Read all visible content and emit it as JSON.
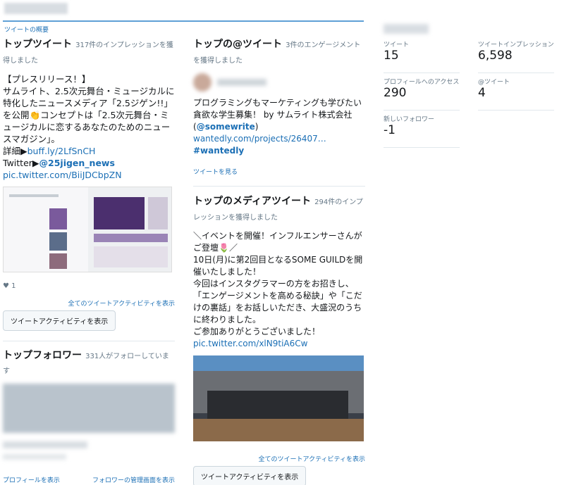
{
  "overview": {
    "label": "ツイートの概要"
  },
  "top_tweet": {
    "title": "トップツイート",
    "sub": "317件のインプレッションを獲得しました",
    "lines": [
      "【プレスリリース！】",
      "サムライト、2.5次元舞台・ミュージカルに特化したニュースメディア「2.5ジゲン!!」を公開👏コンセプトは「2.5次元舞台・ミュージカルに恋するあなたのためのニュースマガジン」。"
    ],
    "detail_prefix": "詳細▶",
    "detail_link": "buff.ly/2LfSnCH",
    "twitter_prefix": "Twitter▶",
    "twitter_handle": "@25jigen_news",
    "pic_link": "pic.twitter.com/BiiJDCbpZN",
    "likes": "1",
    "all_activity": "全てのツイートアクティビティを表示",
    "activity_button": "ツイートアクティビティを表示"
  },
  "top_followers": {
    "title": "トップフォロワー",
    "sub": "331人がフォローしています",
    "view_profile": "プロフィールを表示",
    "manage": "フォロワーの管理画面を表示"
  },
  "top_mention": {
    "title": "トップの@ツイート",
    "sub": "3件のエンゲージメントを獲得しました",
    "text": "プログラミングもマーケティングも学びたい貪欲な学生募集！ by サムライト株式会社",
    "handle": "@somewrite",
    "link": "wantedly.com/projects/26407…",
    "hashtag": "#wantedly",
    "view_tweet": "ツイートを見る"
  },
  "top_media": {
    "title": "トップのメディアツイート",
    "sub": "294件のインプレッションを獲得しました",
    "lines": [
      "＼イベントを開催！インフルエンサーさんがご登壇🌷／",
      "10日(月)に第2回目となるSOME GUILDを開催いたしました！",
      "今回はインスタグラマーの方をお招きし、「エンゲージメントを高める秘訣」や「こだけの裏話」をお話しいただき、大盛況のうちに終わりました。",
      "ご参加ありがとうございました！"
    ],
    "pic_link": "pic.twitter.com/xlN9tiA6Cw",
    "all_activity": "全てのツイートアクティビティを表示",
    "activity_button": "ツイートアクティビティを表示"
  },
  "stats": [
    {
      "label": "ツイート",
      "value": "15"
    },
    {
      "label": "ツイートインプレッション",
      "value": "6,598"
    },
    {
      "label": "プロフィールへのアクセス",
      "value": "290"
    },
    {
      "label": "@ツイート",
      "value": "4"
    },
    {
      "label": "新しいフォロワー",
      "value": "-1"
    }
  ],
  "colors": {
    "link": "#1b6fb5",
    "accent_rule": "#5fa0d6"
  }
}
